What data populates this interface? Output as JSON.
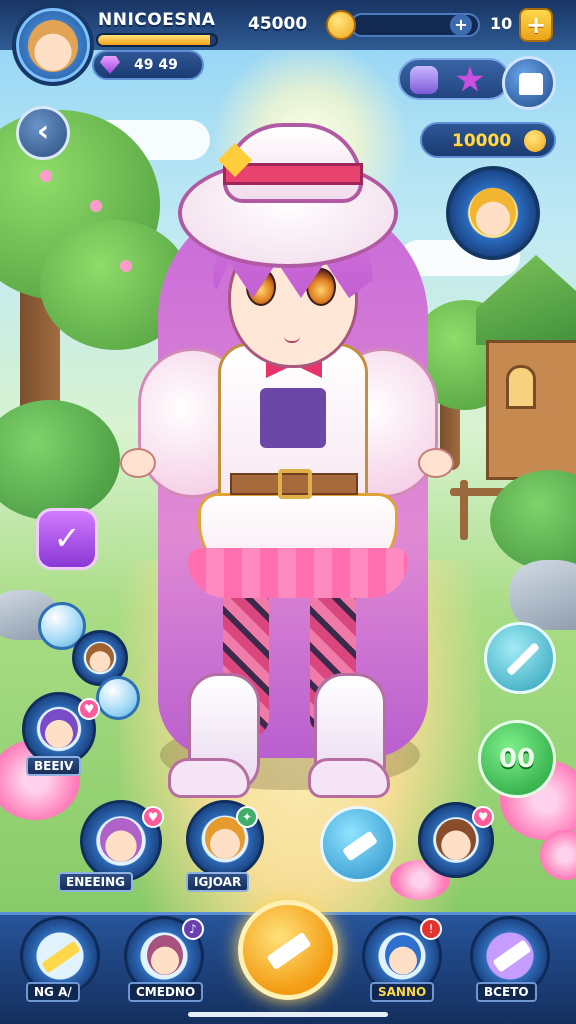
{
  "hud": {
    "player_name": "NNICOESNA",
    "xp_fraction": 0.95,
    "gems": "49 49",
    "score": "45000",
    "energy": "10",
    "plus_label": "+",
    "plus_mini_label": "+",
    "gold": "10000",
    "back_label": "‹"
  },
  "side": {
    "check_label": "✓",
    "green_label": "00",
    "party_label_1": "BEEIV"
  },
  "team": {
    "slot_1_label": "ENEEING",
    "slot_2_label": "IGJOAR"
  },
  "bottom_nav": {
    "item_1_label": "NG   A/",
    "item_2_label": "CMEDNO",
    "item_3_label": "SANNO",
    "item_4_label": "BCETO"
  },
  "colors": {
    "accent_gold": "#f3a21b",
    "hud_navy": "#1b3b72",
    "hair_pink": "#c86bd8",
    "action_green": "#1f9e3a"
  },
  "icons": [
    "avatar",
    "gem-icon",
    "coin-icon",
    "plus-icon",
    "inventory-icon",
    "star-icon",
    "castle-icon",
    "back-arrow-icon",
    "check-icon",
    "sword-icon",
    "hammer-icon",
    "magic-icon",
    "rocket-icon"
  ]
}
